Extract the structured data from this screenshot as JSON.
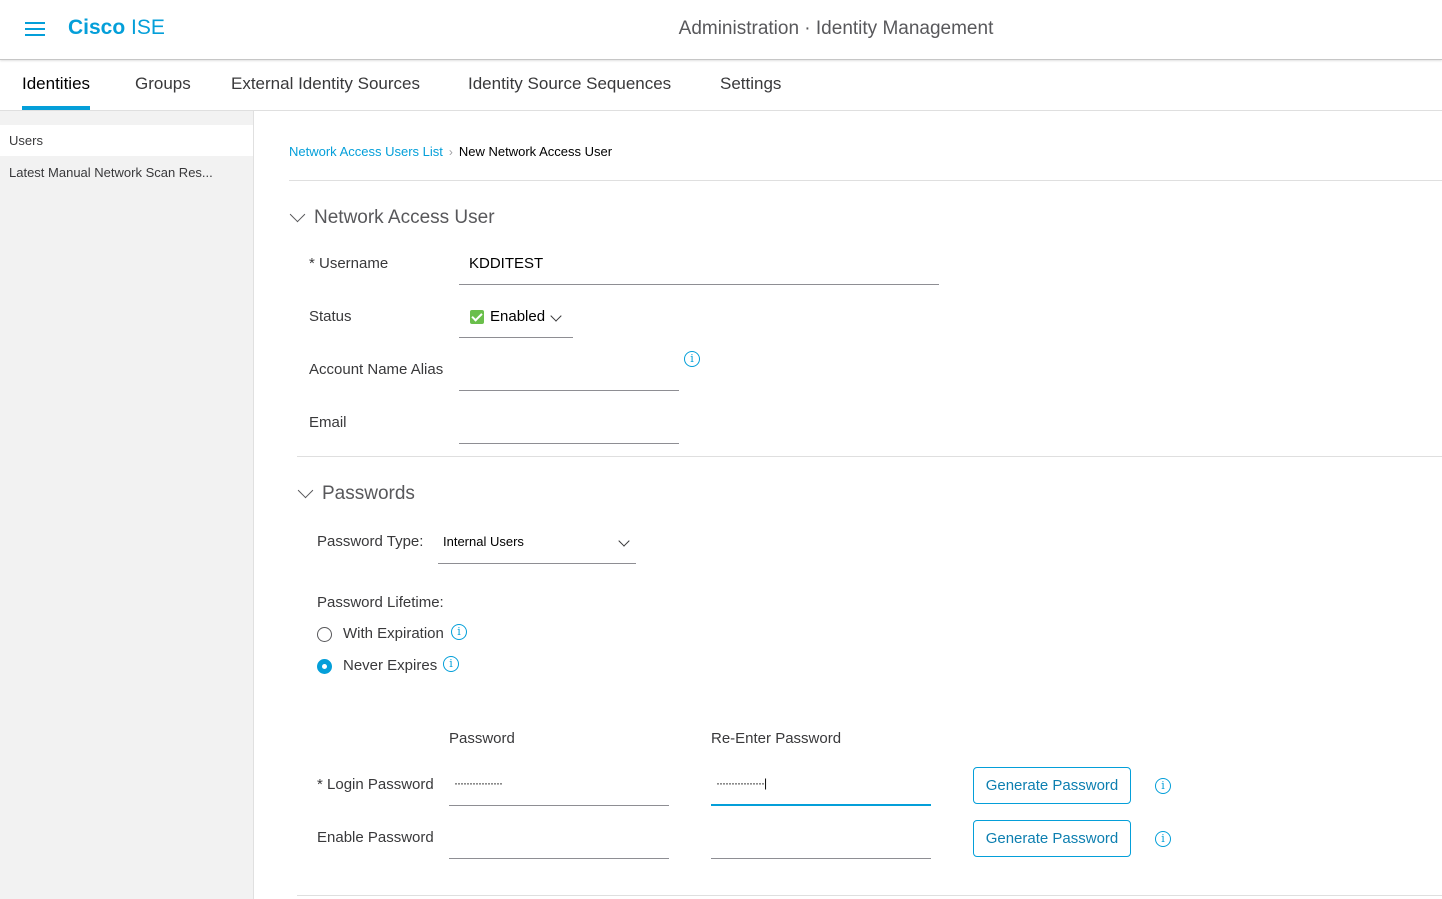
{
  "header": {
    "brand_bold": "Cisco",
    "brand_light": "ISE",
    "page_title": "Administration · Identity Management"
  },
  "tabs": [
    {
      "label": "Identities",
      "active": true
    },
    {
      "label": "Groups"
    },
    {
      "label": "External Identity Sources"
    },
    {
      "label": "Identity Source Sequences"
    },
    {
      "label": "Settings"
    }
  ],
  "sidebar": {
    "items": [
      {
        "label": "Users",
        "selected": true
      },
      {
        "label": "Latest Manual Network Scan Res..."
      }
    ]
  },
  "breadcrumb": {
    "parent": "Network Access Users List",
    "current": "New Network Access User"
  },
  "user_section": {
    "title": "Network Access User",
    "username_label": "* Username",
    "username_value": "KDDITEST",
    "status_label": "Status",
    "status_value": "Enabled",
    "alias_label": "Account Name Alias",
    "alias_value": "",
    "email_label": "Email",
    "email_value": ""
  },
  "passwords_section": {
    "title": "Passwords",
    "type_label": "Password Type:",
    "type_value": "Internal Users",
    "lifetime_label": "Password Lifetime:",
    "with_expiration_label": "With Expiration",
    "never_expires_label": "Never Expires",
    "selected_lifetime": "Never Expires",
    "col_password": "Password",
    "col_reenter": "Re-Enter Password",
    "login_label": "* Login Password",
    "login_value": "················",
    "login_reenter_value": "················|",
    "enable_label": "Enable Password",
    "enable_value": "",
    "enable_reenter_value": "",
    "generate_label": "Generate Password"
  },
  "colors": {
    "accent": "#049fd9",
    "checkbox_green": "#6abf4b"
  },
  "icons": [
    "hamburger-menu-icon",
    "chevron-down-icon",
    "info-icon",
    "checkbox-checked-icon"
  ]
}
